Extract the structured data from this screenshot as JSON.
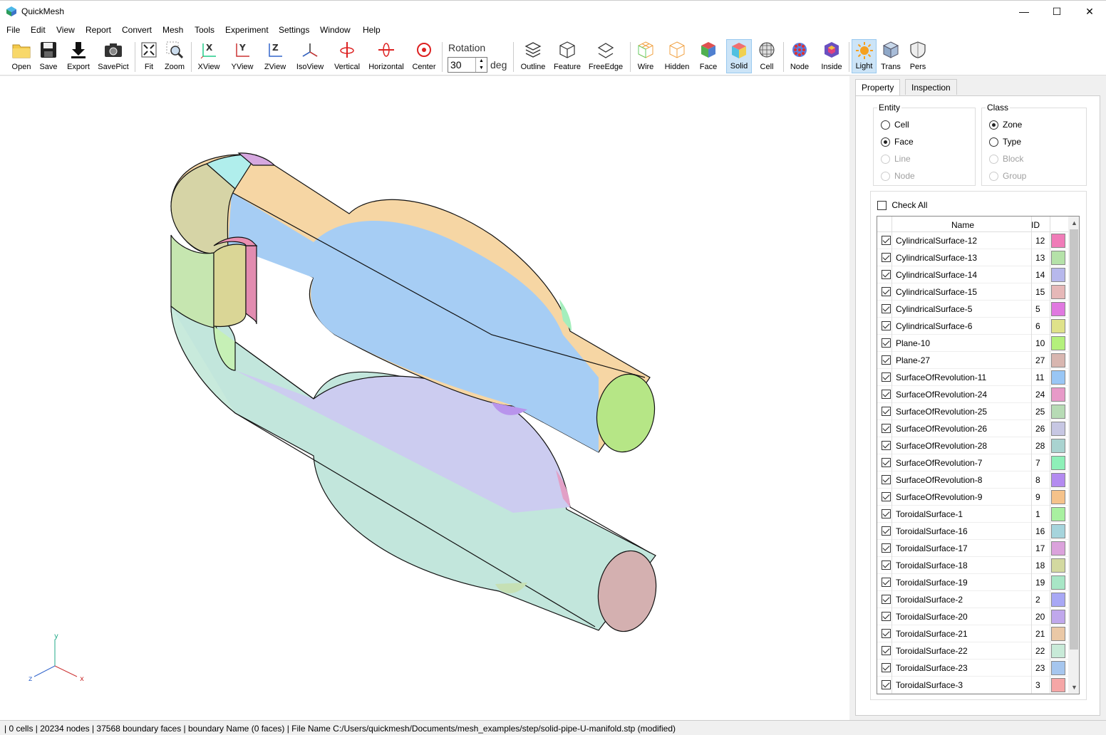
{
  "window": {
    "title": "QuickMesh",
    "minimize": "—",
    "maximize": "☐",
    "close": "✕"
  },
  "menu": [
    "File",
    "Edit",
    "View",
    "Report",
    "Convert",
    "Mesh",
    "Tools",
    "Experiment",
    "Settings",
    "Window",
    "Help"
  ],
  "toolbar": {
    "open": "Open",
    "save": "Save",
    "export": "Export",
    "savepict": "SavePict",
    "fit": "Fit",
    "zoom": "Zoom",
    "xview": "XView",
    "yview": "YView",
    "zview": "ZView",
    "isoview": "IsoView",
    "vertical": "Vertical",
    "horizontal": "Horizontal",
    "center": "Center",
    "rotation_label": "Rotation",
    "rotation_value": "30",
    "deg": "deg",
    "outline": "Outline",
    "feature": "Feature",
    "freeedge": "FreeEdge",
    "wire": "Wire",
    "hidden": "Hidden",
    "face": "Face",
    "solid": "Solid",
    "cell": "Cell",
    "node": "Node",
    "inside": "Inside",
    "light": "Light",
    "trans": "Trans",
    "pers": "Pers"
  },
  "axes": {
    "x": "x",
    "y": "y",
    "z": "z"
  },
  "tabs": {
    "property": "Property",
    "inspection": "Inspection"
  },
  "entity": {
    "title": "Entity",
    "options": [
      "Cell",
      "Face",
      "Line",
      "Node"
    ],
    "selected": "Face"
  },
  "class": {
    "title": "Class",
    "options": [
      "Zone",
      "Type",
      "Block",
      "Group"
    ],
    "selected": "Zone"
  },
  "check_all": "Check All",
  "list": {
    "header_name": "Name",
    "header_id": "ID",
    "rows": [
      {
        "name": "CylindricalSurface-12",
        "id": "12",
        "color": "#f07cb8"
      },
      {
        "name": "CylindricalSurface-13",
        "id": "13",
        "color": "#b5e2a9"
      },
      {
        "name": "CylindricalSurface-14",
        "id": "14",
        "color": "#b7b8ec"
      },
      {
        "name": "CylindricalSurface-15",
        "id": "15",
        "color": "#e6b8b8"
      },
      {
        "name": "CylindricalSurface-5",
        "id": "5",
        "color": "#e078e0"
      },
      {
        "name": "CylindricalSurface-6",
        "id": "6",
        "color": "#dfe28a"
      },
      {
        "name": "Plane-10",
        "id": "10",
        "color": "#b4f07c"
      },
      {
        "name": "Plane-27",
        "id": "27",
        "color": "#d8b6b0"
      },
      {
        "name": "SurfaceOfRevolution-11",
        "id": "11",
        "color": "#99c6f5"
      },
      {
        "name": "SurfaceOfRevolution-24",
        "id": "24",
        "color": "#e79ac8"
      },
      {
        "name": "SurfaceOfRevolution-25",
        "id": "25",
        "color": "#b7dbb5"
      },
      {
        "name": "SurfaceOfRevolution-26",
        "id": "26",
        "color": "#c7c7e3"
      },
      {
        "name": "SurfaceOfRevolution-28",
        "id": "28",
        "color": "#a9d3d0"
      },
      {
        "name": "SurfaceOfRevolution-7",
        "id": "7",
        "color": "#8ef0b8"
      },
      {
        "name": "SurfaceOfRevolution-8",
        "id": "8",
        "color": "#b38af0"
      },
      {
        "name": "SurfaceOfRevolution-9",
        "id": "9",
        "color": "#f5c28a"
      },
      {
        "name": "ToroidalSurface-1",
        "id": "1",
        "color": "#a8f0a0"
      },
      {
        "name": "ToroidalSurface-16",
        "id": "16",
        "color": "#a6d4dc"
      },
      {
        "name": "ToroidalSurface-17",
        "id": "17",
        "color": "#dba2dc"
      },
      {
        "name": "ToroidalSurface-18",
        "id": "18",
        "color": "#d3d9a0"
      },
      {
        "name": "ToroidalSurface-19",
        "id": "19",
        "color": "#a8e6c6"
      },
      {
        "name": "ToroidalSurface-2",
        "id": "2",
        "color": "#a8a8f5"
      },
      {
        "name": "ToroidalSurface-20",
        "id": "20",
        "color": "#c0a8ec"
      },
      {
        "name": "ToroidalSurface-21",
        "id": "21",
        "color": "#eac8a6"
      },
      {
        "name": "ToroidalSurface-22",
        "id": "22",
        "color": "#c8ead8"
      },
      {
        "name": "ToroidalSurface-23",
        "id": "23",
        "color": "#a6c6ee"
      },
      {
        "name": "ToroidalSurface-3",
        "id": "3",
        "color": "#f5a6a6"
      }
    ]
  },
  "status": "| 0 cells | 20234 nodes | 37568 boundary faces |  boundary Name  (0 faces) | File Name C:/Users/quickmesh/Documents/mesh_examples/step/solid-pipe-U-manifold.stp (modified)"
}
